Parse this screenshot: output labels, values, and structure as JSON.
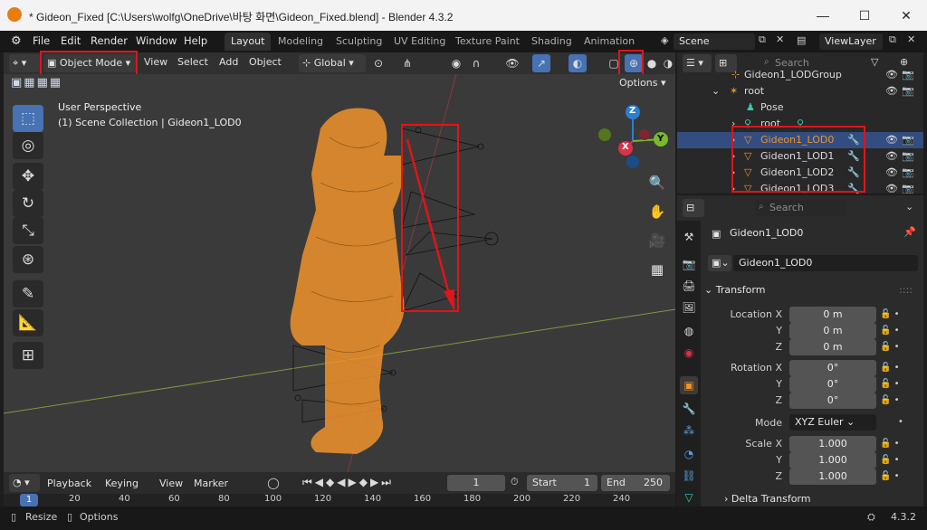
{
  "window": {
    "title": "* Gideon_Fixed [C:\\Users\\wolfg\\OneDrive\\바탕 화면\\Gideon_Fixed.blend] - Blender 4.3.2",
    "minimize": "—",
    "maximize": "☐",
    "close": "✕"
  },
  "menu": [
    "File",
    "Edit",
    "Render",
    "Window",
    "Help"
  ],
  "workspaces": [
    "Layout",
    "Modeling",
    "Sculpting",
    "UV Editing",
    "Texture Paint",
    "Shading",
    "Animation"
  ],
  "scene_label": "Scene",
  "viewlayer_label": "ViewLayer",
  "viewport_header": {
    "mode": "Object Mode",
    "menus": [
      "View",
      "Select",
      "Add",
      "Object"
    ],
    "orientation": "Global",
    "options": "Options"
  },
  "viewport": {
    "perspective": "User Perspective",
    "collection_info": "(1) Scene Collection | Gideon1_LOD0",
    "gizmo": {
      "z": "Z",
      "y": "Y",
      "x": "X"
    }
  },
  "outliner": {
    "search_placeholder": "Search",
    "rows": [
      {
        "name": "Gideon1_LODGroup",
        "type": "empty"
      },
      {
        "name": "root",
        "type": "armature"
      },
      {
        "name": "Pose",
        "type": "pose"
      },
      {
        "name": "root",
        "type": "bone"
      },
      {
        "name": "Gideon1_LOD0",
        "type": "mesh",
        "selected": true
      },
      {
        "name": "Gideon1_LOD1",
        "type": "mesh"
      },
      {
        "name": "Gideon1_LOD2",
        "type": "mesh"
      },
      {
        "name": "Gideon1_LOD3",
        "type": "mesh"
      }
    ]
  },
  "properties": {
    "search_placeholder": "Search",
    "object_name": "Gideon1_LOD0",
    "object_field": "Gideon1_LOD0",
    "panel_transform": "Transform",
    "location": {
      "label": "Location X",
      "x": "0 m",
      "y": "0 m",
      "z": "0 m"
    },
    "rotation": {
      "label": "Rotation X",
      "x": "0°",
      "y": "0°",
      "z": "0°"
    },
    "mode_label": "Mode",
    "mode_value": "XYZ Euler",
    "scale": {
      "label": "Scale X",
      "x": "1.000",
      "y": "1.000",
      "z": "1.000"
    },
    "axis_y": "Y",
    "axis_z": "Z",
    "delta_transform": "Delta Transform"
  },
  "timeline": {
    "menus": [
      "Playback",
      "Keying",
      "View",
      "Marker"
    ],
    "current_frame": "1",
    "start_label": "Start",
    "start": "1",
    "end_label": "End",
    "end": "250",
    "ruler": [
      "1",
      "20",
      "40",
      "60",
      "80",
      "100",
      "120",
      "140",
      "160",
      "180",
      "200",
      "220",
      "240"
    ]
  },
  "statusbar": {
    "left1": "Resize",
    "left2": "Options",
    "version": "4.3.2"
  },
  "colors": {
    "accent": "#4772b3",
    "selection_orange": "#f0932b",
    "highlight_red": "#e0141a"
  }
}
